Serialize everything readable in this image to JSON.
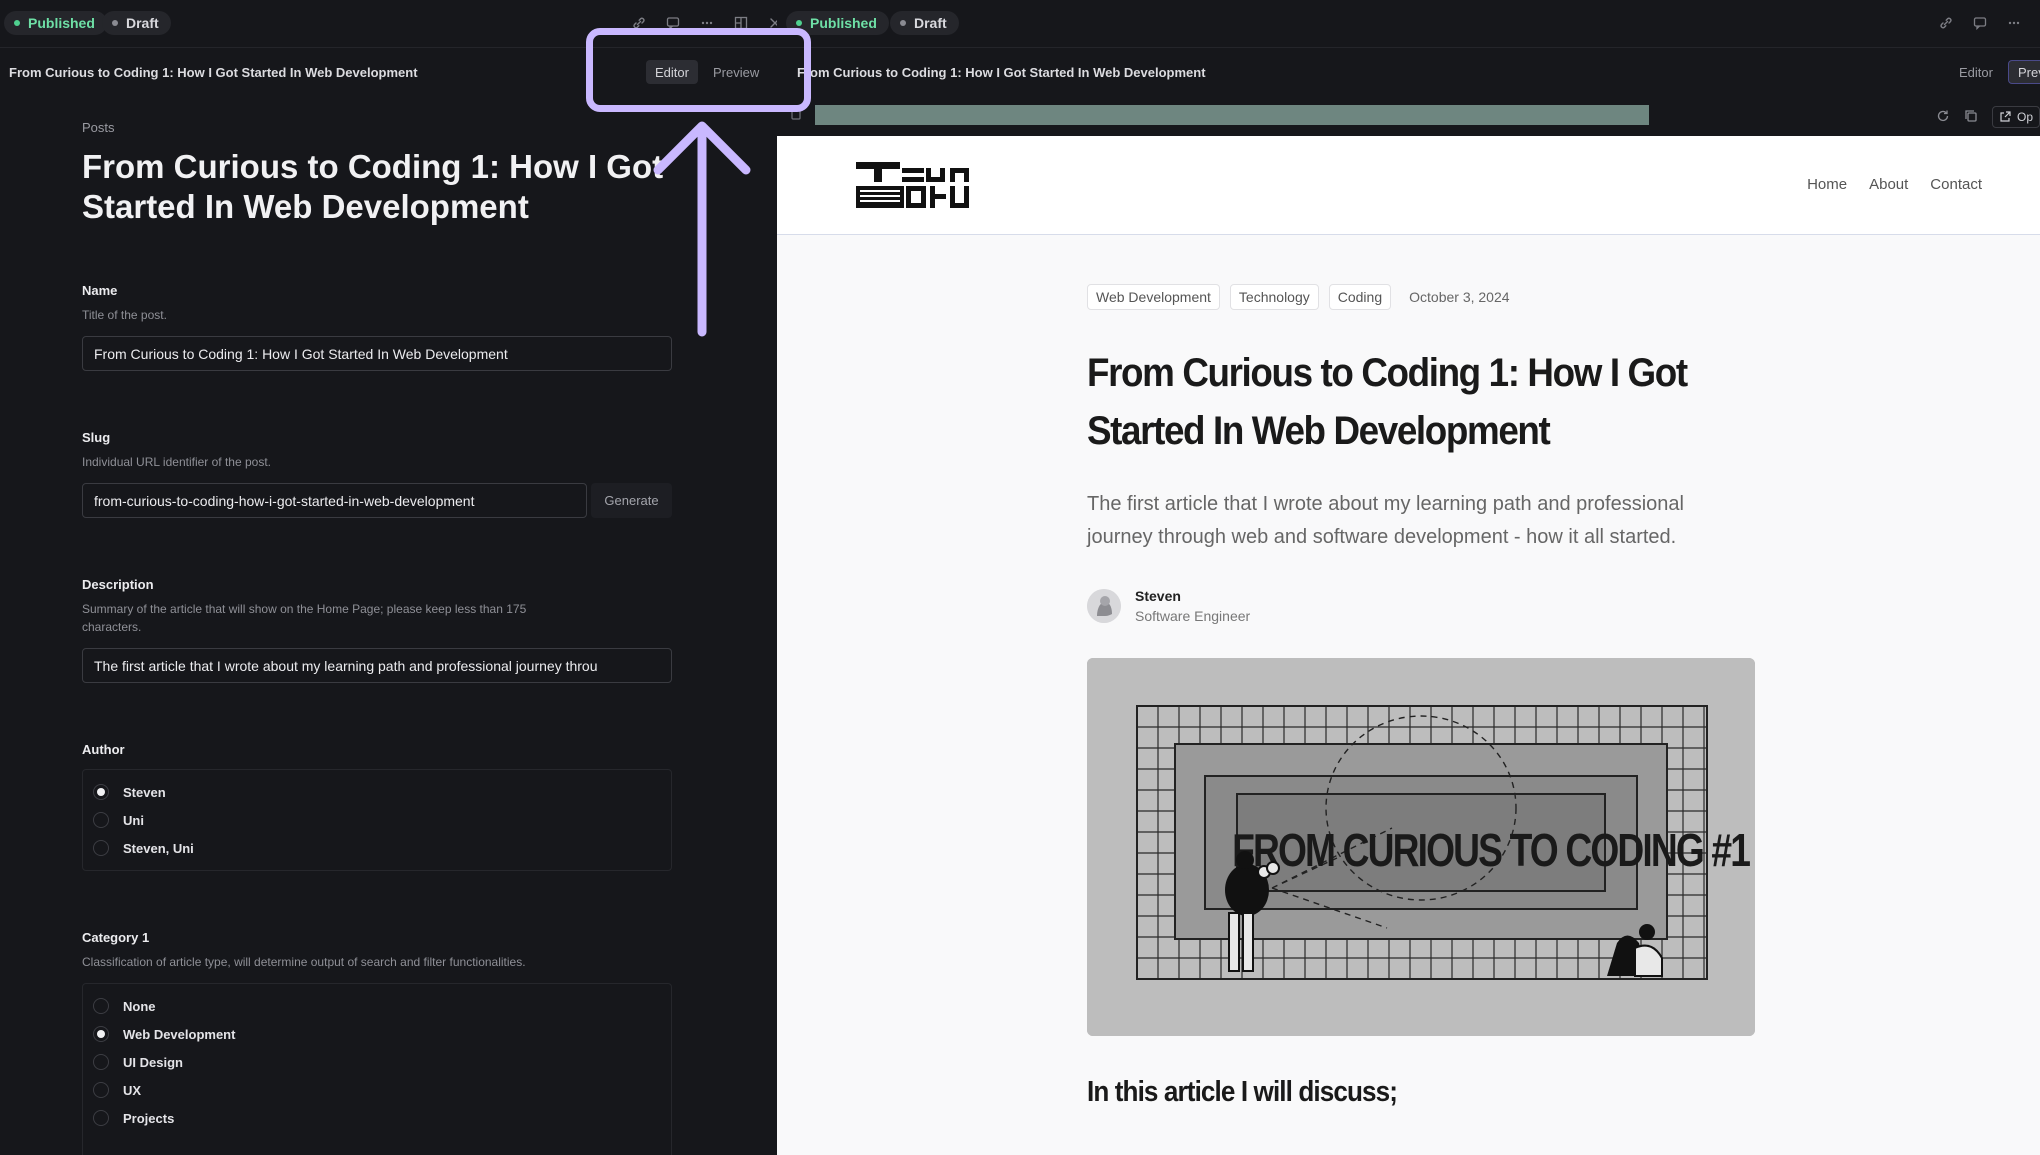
{
  "left_pane": {
    "status": {
      "published": "Published",
      "draft": "Draft"
    },
    "doc_title": "From Curious to Coding 1: How I Got Started In Web Development",
    "modes": {
      "editor": "Editor",
      "preview": "Preview"
    },
    "breadcrumb": "Posts",
    "page_title": "From Curious to Coding 1: How I Got Started In Web Development",
    "fields": {
      "name": {
        "label": "Name",
        "help": "Title of the post.",
        "value": "From Curious to Coding 1: How I Got Started In Web Development"
      },
      "slug": {
        "label": "Slug",
        "help": "Individual URL identifier of the post.",
        "value": "from-curious-to-coding-how-i-got-started-in-web-development",
        "button": "Generate"
      },
      "description": {
        "label": "Description",
        "help": "Summary of the article that will show on the Home Page; please keep less than 175 characters.",
        "value": "The first article that I wrote about my learning path and professional journey throu"
      },
      "author": {
        "label": "Author",
        "options": [
          "Steven",
          "Uni",
          "Steven, Uni"
        ],
        "selected": 0
      },
      "category1": {
        "label": "Category 1",
        "help": "Classification of article type, will determine output of search and filter functionalities.",
        "options": [
          "None",
          "Web Development",
          "UI Design",
          "UX",
          "Projects"
        ],
        "selected": 1
      }
    }
  },
  "right_pane": {
    "status": {
      "published": "Published",
      "draft": "Draft"
    },
    "doc_title": "From Curious to Coding 1: How I Got Started In Web Development",
    "modes": {
      "editor": "Editor",
      "preview": "Previ"
    },
    "open_label": "Op",
    "site": {
      "logo_text": "TZUN BOKU",
      "nav": [
        "Home",
        "About",
        "Contact"
      ],
      "tags": [
        "Web Development",
        "Technology",
        "Coding"
      ],
      "date": "October 3, 2024",
      "title": "From Curious to Coding 1: How I Got Started In Web Development",
      "subtitle": "The first article that I wrote about my learning path and professional journey through web and software development - how it all started.",
      "author": {
        "name": "Steven",
        "role": "Software Engineer"
      },
      "hero_text": "FROM CURIOUS TO CODING #1",
      "section_heading": "In this article I will discuss;"
    }
  },
  "colors": {
    "highlight": "#c9b8ff",
    "published": "#4fd08f",
    "url_bar": "#6e8680"
  }
}
